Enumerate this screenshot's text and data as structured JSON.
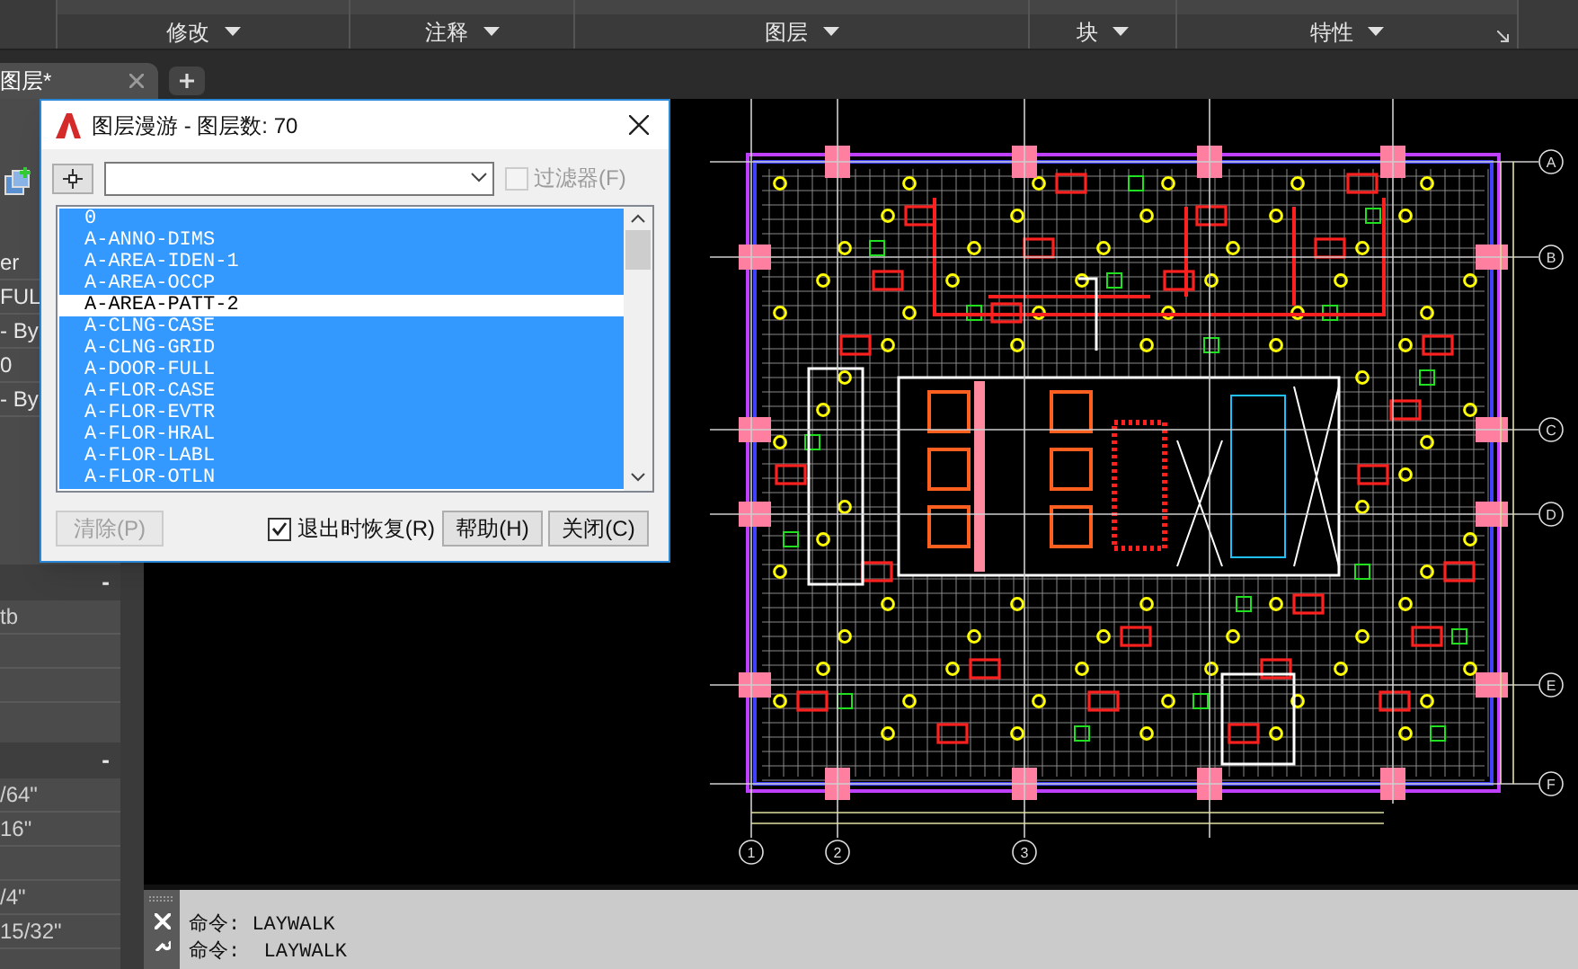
{
  "ribbon": {
    "panels": [
      {
        "label": "修改"
      },
      {
        "label": "注释"
      },
      {
        "label": "图层"
      },
      {
        "label": "块"
      },
      {
        "label": "特性"
      }
    ]
  },
  "document_tabs": [
    {
      "label": "图层*",
      "selected": true
    }
  ],
  "properties_palette": {
    "rows": [
      "er",
      "FUL",
      "- By",
      "0",
      "- By"
    ],
    "sections": [
      {
        "toggle": "-",
        "rows": [
          "tb",
          "",
          ""
        ]
      },
      {
        "toggle": "-",
        "rows": [
          "/64\"",
          "16\"",
          "",
          "/4\"",
          "15/32\""
        ]
      }
    ]
  },
  "dialog": {
    "title": "图层漫游 - 图层数: 70",
    "filter": {
      "label": "过滤器(F)",
      "checked": false,
      "disabled": true
    },
    "layers": [
      {
        "name": "0",
        "selected": true
      },
      {
        "name": "A-ANNO-DIMS",
        "selected": true
      },
      {
        "name": "A-AREA-IDEN-1",
        "selected": true
      },
      {
        "name": "A-AREA-OCCP",
        "selected": true
      },
      {
        "name": "A-AREA-PATT-2",
        "selected": false
      },
      {
        "name": "A-CLNG-CASE",
        "selected": true
      },
      {
        "name": "A-CLNG-GRID",
        "selected": true
      },
      {
        "name": "A-DOOR-FULL",
        "selected": true
      },
      {
        "name": "A-FLOR-CASE",
        "selected": true
      },
      {
        "name": "A-FLOR-EVTR",
        "selected": true
      },
      {
        "name": "A-FLOR-HRAL",
        "selected": true
      },
      {
        "name": "A-FLOR-LABL",
        "selected": true
      },
      {
        "name": "A-FLOR-OTLN",
        "selected": true
      }
    ],
    "footer": [
      {
        "kind": "button",
        "label": "清除(P)",
        "disabled": true
      },
      {
        "kind": "checkbox",
        "label": "退出时恢复(R)",
        "checked": true
      },
      {
        "kind": "button",
        "label": "帮助(H)",
        "disabled": false
      },
      {
        "kind": "button",
        "label": "关闭(C)",
        "disabled": false
      }
    ]
  },
  "drawing": {
    "row_axes": [
      "A",
      "B",
      "C",
      "D",
      "E",
      "F"
    ],
    "column_axes": [
      "1",
      "2",
      "3"
    ]
  },
  "command_line": {
    "history": [
      "命令: LAYWALK",
      "命令:  LAYWALK"
    ]
  }
}
